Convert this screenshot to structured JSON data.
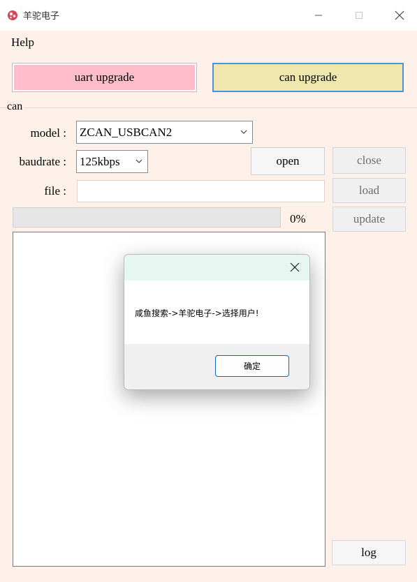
{
  "window": {
    "title": "羊驼电子"
  },
  "menu": {
    "help": "Help"
  },
  "modes": {
    "uart": "uart upgrade",
    "can": "can upgrade"
  },
  "group": {
    "label": "can"
  },
  "form": {
    "model_label": "model :",
    "model_value": "ZCAN_USBCAN2",
    "baudrate_label": "baudrate :",
    "baudrate_value": "125kbps",
    "file_label": "file :",
    "file_value": ""
  },
  "buttons": {
    "open": "open",
    "close": "close",
    "load": "load",
    "update": "update",
    "log": "log"
  },
  "progress": {
    "value": 0,
    "text": "0%"
  },
  "dialog": {
    "message": "咸鱼搜索->羊驼电子->选择用户!",
    "ok": "确定"
  }
}
